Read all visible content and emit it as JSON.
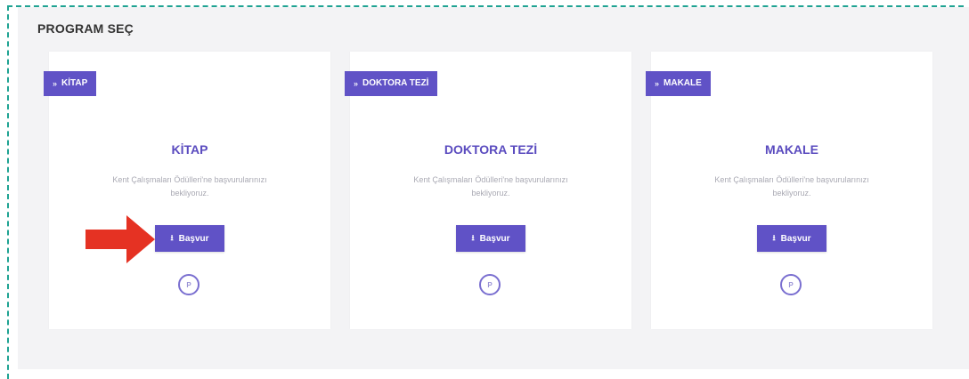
{
  "section": {
    "title": "PROGRAM SEÇ"
  },
  "cards": [
    {
      "ribbon": "KİTAP",
      "title": "KİTAP",
      "description": "Kent Çalışmaları Ödülleri'ne başvurularınızı bekliyoruz.",
      "button": "Başvur",
      "info_icon_glyph": "P"
    },
    {
      "ribbon": "DOKTORA TEZİ",
      "title": "DOKTORA TEZİ",
      "description": "Kent Çalışmaları Ödülleri'ne başvurularınızı bekliyoruz.",
      "button": "Başvur",
      "info_icon_glyph": "P"
    },
    {
      "ribbon": "MAKALE",
      "title": "MAKALE",
      "description": "Kent Çalışmaları Ödülleri'ne başvurularınızı bekliyoruz.",
      "button": "Başvur",
      "info_icon_glyph": "P"
    }
  ],
  "icons": {
    "ribbon": "double-chevron-right-icon",
    "button": "download-icon",
    "info": "circle-p-icon",
    "annotation": "red-arrow-icon"
  },
  "colors": {
    "accent": "#6052c6",
    "title": "#5a4bbf",
    "frame_dashes": "#1fa392",
    "annotation_arrow": "#e53223",
    "panel_background": "#f3f3f5"
  }
}
